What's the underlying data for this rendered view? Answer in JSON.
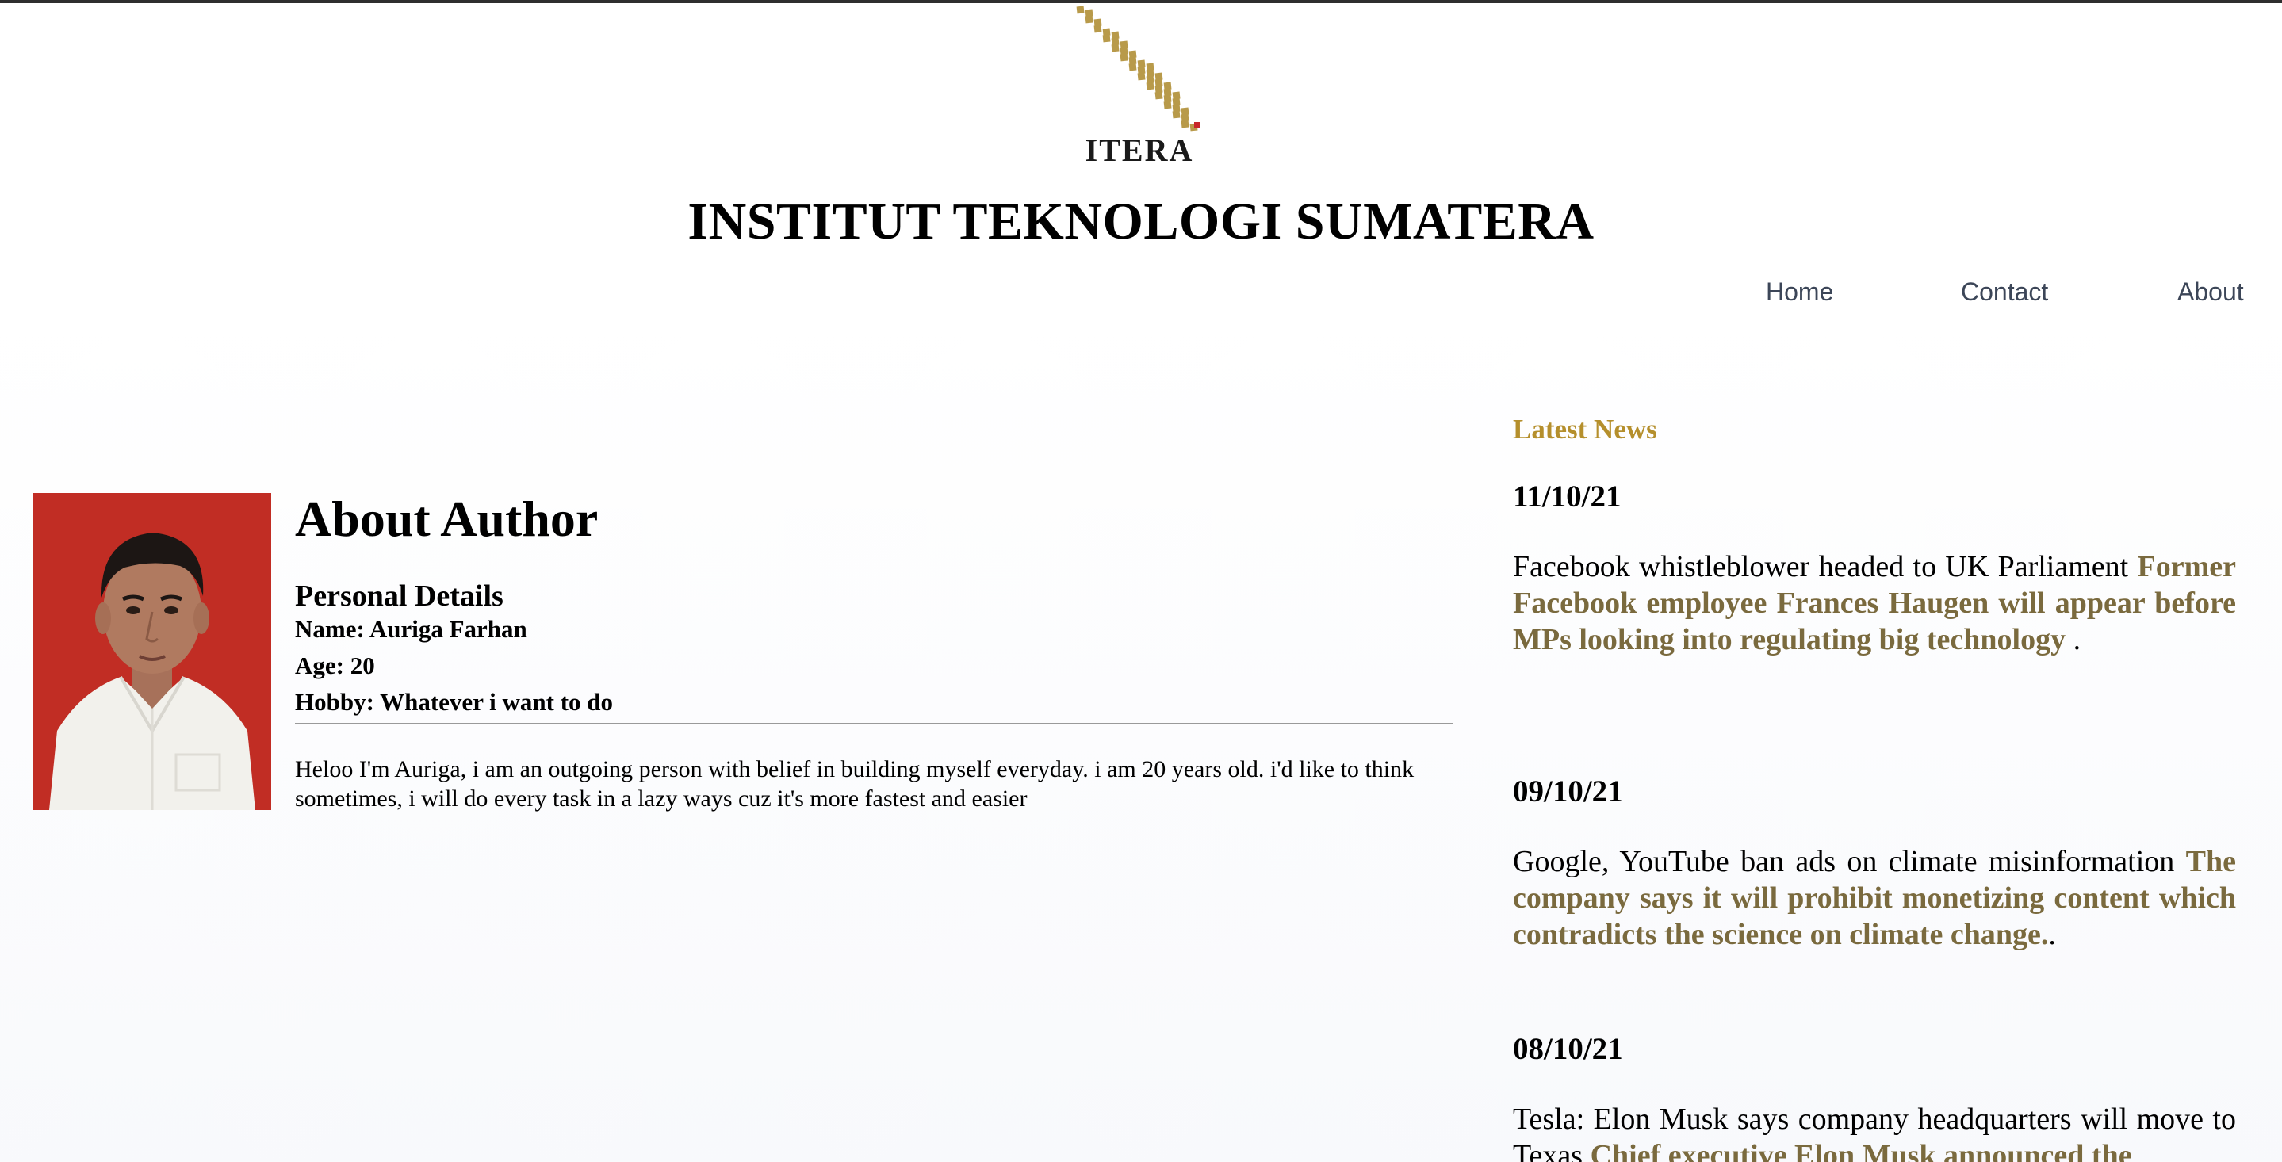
{
  "header": {
    "logo_text": "ITERA",
    "title": "INSTITUT TEKNOLOGI SUMATERA",
    "brand_color": "#b89a4a"
  },
  "nav": {
    "items": [
      {
        "label": "Home"
      },
      {
        "label": "Contact"
      },
      {
        "label": "About"
      }
    ]
  },
  "author": {
    "title": "About Author",
    "details_heading": "Personal Details",
    "name_line": "Name: Auriga Farhan",
    "age_line": "Age: 20",
    "hobby_line": "Hobby: Whatever i want to do",
    "bio": "Heloo I'm Auriga, i am an outgoing person with belief in building myself everyday. i am 20 years old. i'd like to think sometimes, i will do every task in a lazy ways cuz it's more fastest and easier",
    "photo_background": "#c12d24"
  },
  "news": {
    "heading": "Latest News",
    "heading_color": "#b58f2c",
    "link_color": "#7a6a3e",
    "items": [
      {
        "date": "11/10/21",
        "lead": "Facebook whistleblower headed to UK Parliament",
        "summary": "Former Facebook employee Frances Haugen will appear before MPs looking into regulating big technology",
        "end": " ."
      },
      {
        "date": "09/10/21",
        "lead": "Google, YouTube ban ads on climate misinformation",
        "summary": "The company says it will prohibit monetizing content which contradicts the science on climate change.",
        "end": "."
      },
      {
        "date": "08/10/21",
        "lead": "Tesla: Elon Musk says company headquarters will move to Texas",
        "summary": "Chief executive Elon Musk announced the",
        "end": ""
      }
    ]
  }
}
